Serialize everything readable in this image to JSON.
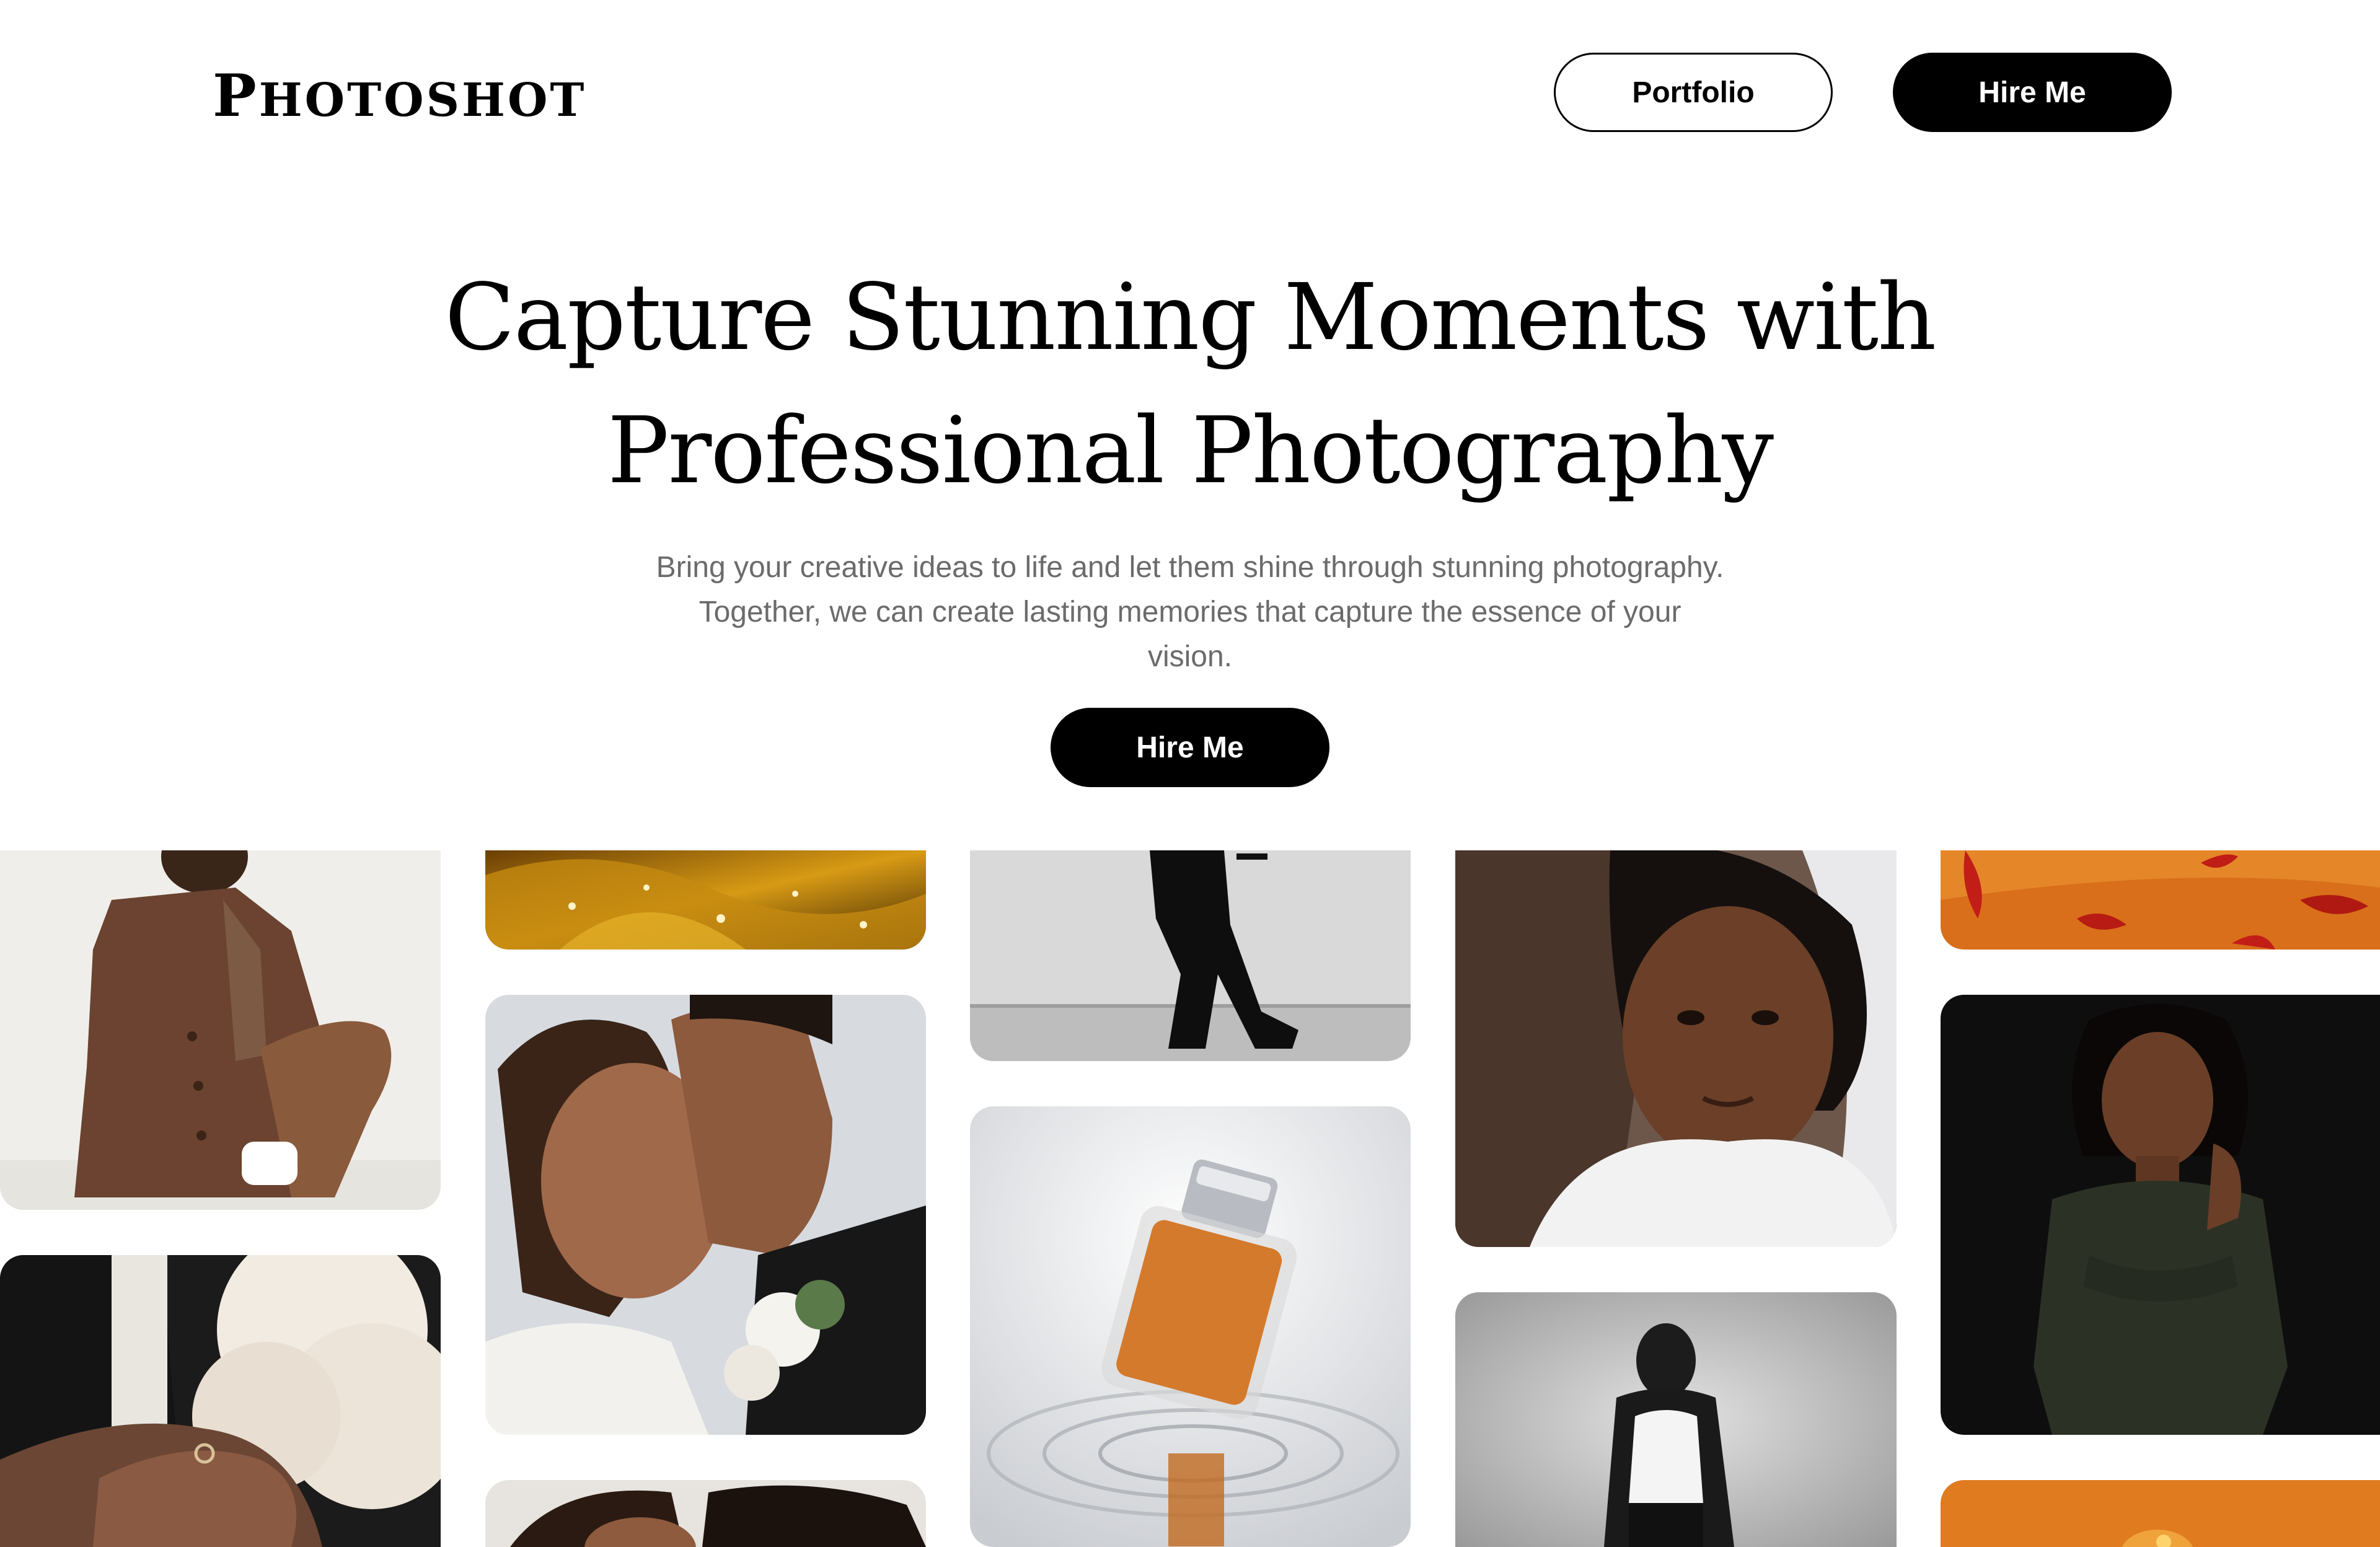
{
  "header": {
    "logo_first": "P",
    "logo_rest": "HOTOSHOT",
    "portfolio_label": "Portfolio",
    "hire_label": "Hire Me"
  },
  "hero": {
    "headline_line1": "Capture Stunning Moments with",
    "headline_line2": "Professional Photography",
    "subtitle_line1": "Bring your creative ideas to life and let them shine through stunning photography.",
    "subtitle_line2": "Together, we can create lasting memories that capture the essence of your",
    "subtitle_line3": "vision.",
    "cta_label": "Hire Me"
  },
  "gallery": {
    "images": [
      {
        "subject": "woman-brown-coat"
      },
      {
        "subject": "couple-rings-flowers"
      },
      {
        "subject": "yellow-petals-dew"
      },
      {
        "subject": "wedding-couple-kiss"
      },
      {
        "subject": "couple-close-up"
      },
      {
        "subject": "silhouette-walking"
      },
      {
        "subject": "perfume-bottle-water"
      },
      {
        "subject": "bride-portrait"
      },
      {
        "subject": "man-tank-top-bw"
      },
      {
        "subject": "orange-chili-peppers"
      },
      {
        "subject": "woman-olive-shirt"
      },
      {
        "subject": "orange-background-product"
      }
    ]
  },
  "colors": {
    "primary": "#000000",
    "background": "#ffffff",
    "subtitle": "#6b6b6b",
    "accent_orange": "#e07b1f"
  }
}
